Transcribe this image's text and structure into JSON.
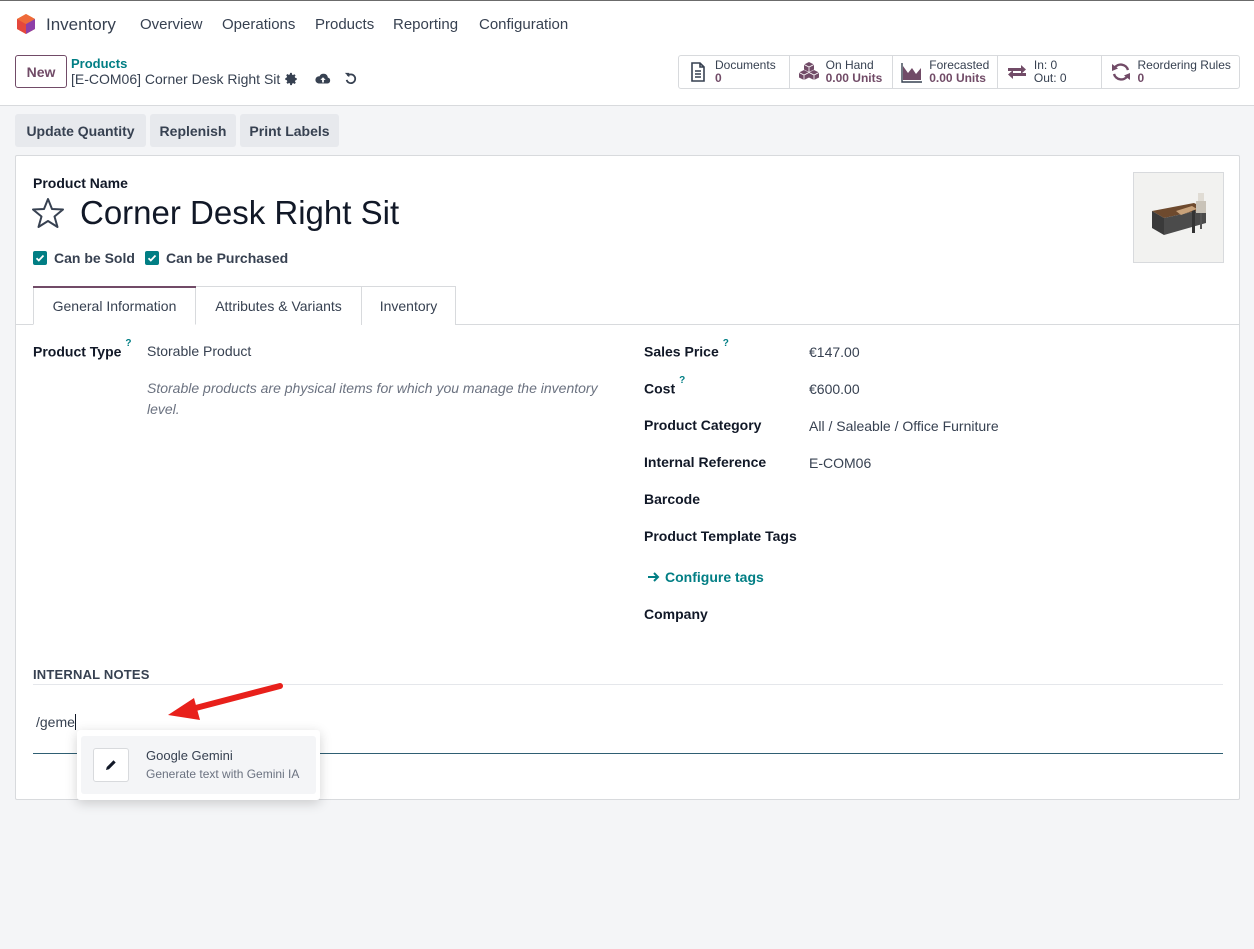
{
  "navbar": {
    "app_name": "Inventory",
    "menu": [
      "Overview",
      "Operations",
      "Products",
      "Reporting",
      "Configuration"
    ]
  },
  "control_panel": {
    "new_label": "New",
    "breadcrumb_parent": "Products",
    "breadcrumb_current": "[E-COM06] Corner Desk Right Sit"
  },
  "smart_buttons": {
    "documents": {
      "title": "Documents",
      "value": "0"
    },
    "on_hand": {
      "title": "On Hand",
      "value": "0.00 Units"
    },
    "forecasted": {
      "title": "Forecasted",
      "value": "0.00 Units"
    },
    "in_out": {
      "in": "In: 0",
      "out": "Out: 0"
    },
    "reordering": {
      "title": "Reordering Rules",
      "value": "0"
    }
  },
  "actions": {
    "update_quantity": "Update Quantity",
    "replenish": "Replenish",
    "print_labels": "Print Labels"
  },
  "form": {
    "product_name_label": "Product Name",
    "product_name": "Corner Desk Right Sit",
    "can_be_sold": "Can be Sold",
    "can_be_purchased": "Can be Purchased",
    "tabs": [
      "General Information",
      "Attributes & Variants",
      "Inventory"
    ],
    "product_type_label": "Product Type",
    "product_type_value": "Storable Product",
    "product_type_hint": "Storable products are physical items for which you manage the inventory level.",
    "sales_price_label": "Sales Price",
    "sales_price_value": "€147.00",
    "cost_label": "Cost",
    "cost_value": "€600.00",
    "category_label": "Product Category",
    "category_value": "All / Saleable / Office Furniture",
    "internal_ref_label": "Internal Reference",
    "internal_ref_value": "E-COM06",
    "barcode_label": "Barcode",
    "tags_label": "Product Template Tags",
    "configure_tags": "Configure tags",
    "company_label": "Company",
    "help_mark": "?"
  },
  "notes": {
    "title": "INTERNAL NOTES",
    "input_text": "/geme"
  },
  "command_popover": {
    "title": "Google Gemini",
    "description": "Generate text with Gemini IA"
  },
  "colors": {
    "brand": "#714b67",
    "accent": "#017e84",
    "annotation_arrow": "#e8201b"
  }
}
